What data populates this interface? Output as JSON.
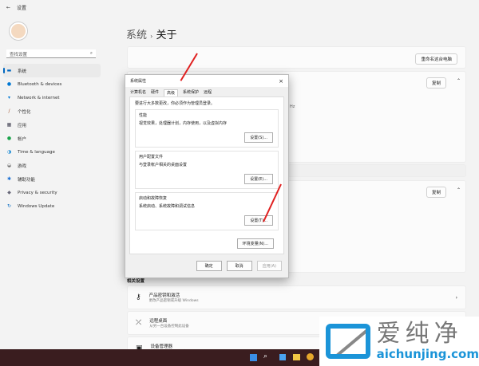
{
  "window": {
    "title": "设置",
    "back_icon": "←"
  },
  "search": {
    "placeholder": "查找设置"
  },
  "sidebar": {
    "items": [
      {
        "label": "系统",
        "icon": "▬",
        "color": "#0067c0"
      },
      {
        "label": "Bluetooth & devices",
        "icon": "●",
        "color": "#0078d4"
      },
      {
        "label": "Network & internet",
        "icon": "▾",
        "color": "#0078d4"
      },
      {
        "label": "个性化",
        "icon": "/",
        "color": "#a0522d"
      },
      {
        "label": "应用",
        "icon": "▦",
        "color": "#445"
      },
      {
        "label": "帐户",
        "icon": "●",
        "color": "#1aa34a"
      },
      {
        "label": "Time & language",
        "icon": "◑",
        "color": "#1a8ad4"
      },
      {
        "label": "游戏",
        "icon": "◒",
        "color": "#777"
      },
      {
        "label": "辅助功能",
        "icon": "✱",
        "color": "#1a6fd4"
      },
      {
        "label": "Privacy & security",
        "icon": "◆",
        "color": "#667"
      },
      {
        "label": "Windows Update",
        "icon": "↻",
        "color": "#0067c0"
      }
    ]
  },
  "breadcrumb": {
    "parent": "系统",
    "separator": "›",
    "current": "关于"
  },
  "main": {
    "rename_button": "重命名这台电脑",
    "copy_button_1": "复制",
    "copy_button_2": "复制",
    "partial_text": "Hz",
    "related_heading": "相关设置",
    "related": [
      {
        "title": "产品密钥和激活",
        "subtitle": "更改产品密钥或升级 Windows"
      },
      {
        "title": "远程桌面",
        "subtitle": "从另一台设备控制此设备"
      },
      {
        "title": "设备管理器",
        "subtitle": "打印机和其他驱动程序、硬件属性"
      }
    ]
  },
  "dialog": {
    "title": "系统属性",
    "tabs": [
      "计算机名",
      "硬件",
      "高级",
      "系统保护",
      "远程"
    ],
    "note": "要进行大多数更改，你必须作为管理员登录。",
    "groups": [
      {
        "title": "性能",
        "desc": "视觉效果，处理器计划，内存使用，以及虚拟内存",
        "button": "设置(S)..."
      },
      {
        "title": "用户配置文件",
        "desc": "与登录帐户相关的桌面设置",
        "button": "设置(E)..."
      },
      {
        "title": "启动和故障恢复",
        "desc": "系统启动、系统故障和调试信息",
        "button": "设置(T)..."
      }
    ],
    "env_button": "环境变量(N)...",
    "ok": "确定",
    "cancel": "取消",
    "apply": "应用(A)"
  },
  "watermark": {
    "brand": "爱纯净",
    "url": "aichunjing.com"
  }
}
